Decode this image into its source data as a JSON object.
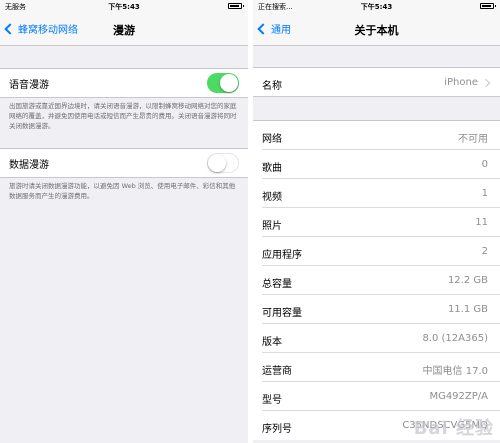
{
  "left": {
    "status": {
      "carrier": "无服务",
      "time": "下午5:43"
    },
    "nav": {
      "back": "蜂窝移动网络",
      "title": "漫游"
    },
    "voice_roaming": {
      "label": "语音漫游",
      "on": true,
      "note": "出国旅游或靠近国界边境时，请关闭语音漫游，以限制蜂窝移动网络对您的家庭网络的覆盖，并避免因使用电话或短信而产生昂贵的费用。关闭语音漫游将同时关闭数据漫游。"
    },
    "data_roaming": {
      "label": "数据漫游",
      "on": false,
      "note": "旅游时请关闭数据漫游功能，以避免因 Web 浏览、使用电子邮件、彩信和其他数据服务而产生的漫游费用。"
    }
  },
  "right": {
    "status": {
      "carrier": "正在搜索...",
      "time": "下午5:43"
    },
    "nav": {
      "back": "通用",
      "title": "关于本机"
    },
    "name_row": {
      "label": "名称",
      "value": "iPhone"
    },
    "rows": [
      {
        "label": "网络",
        "value": "不可用"
      },
      {
        "label": "歌曲",
        "value": "0"
      },
      {
        "label": "视频",
        "value": "1"
      },
      {
        "label": "照片",
        "value": "11"
      },
      {
        "label": "应用程序",
        "value": "2"
      },
      {
        "label": "总容量",
        "value": "12.2 GB"
      },
      {
        "label": "可用容量",
        "value": "11.1 GB"
      },
      {
        "label": "版本",
        "value": "8.0 (12A365)"
      },
      {
        "label": "运营商",
        "value": "中国电信 17.0"
      },
      {
        "label": "型号",
        "value": "MG492ZP/A"
      },
      {
        "label": "序列号",
        "value": "C35NDSCVG5MQ"
      }
    ]
  },
  "watermark": "Bai 经验"
}
